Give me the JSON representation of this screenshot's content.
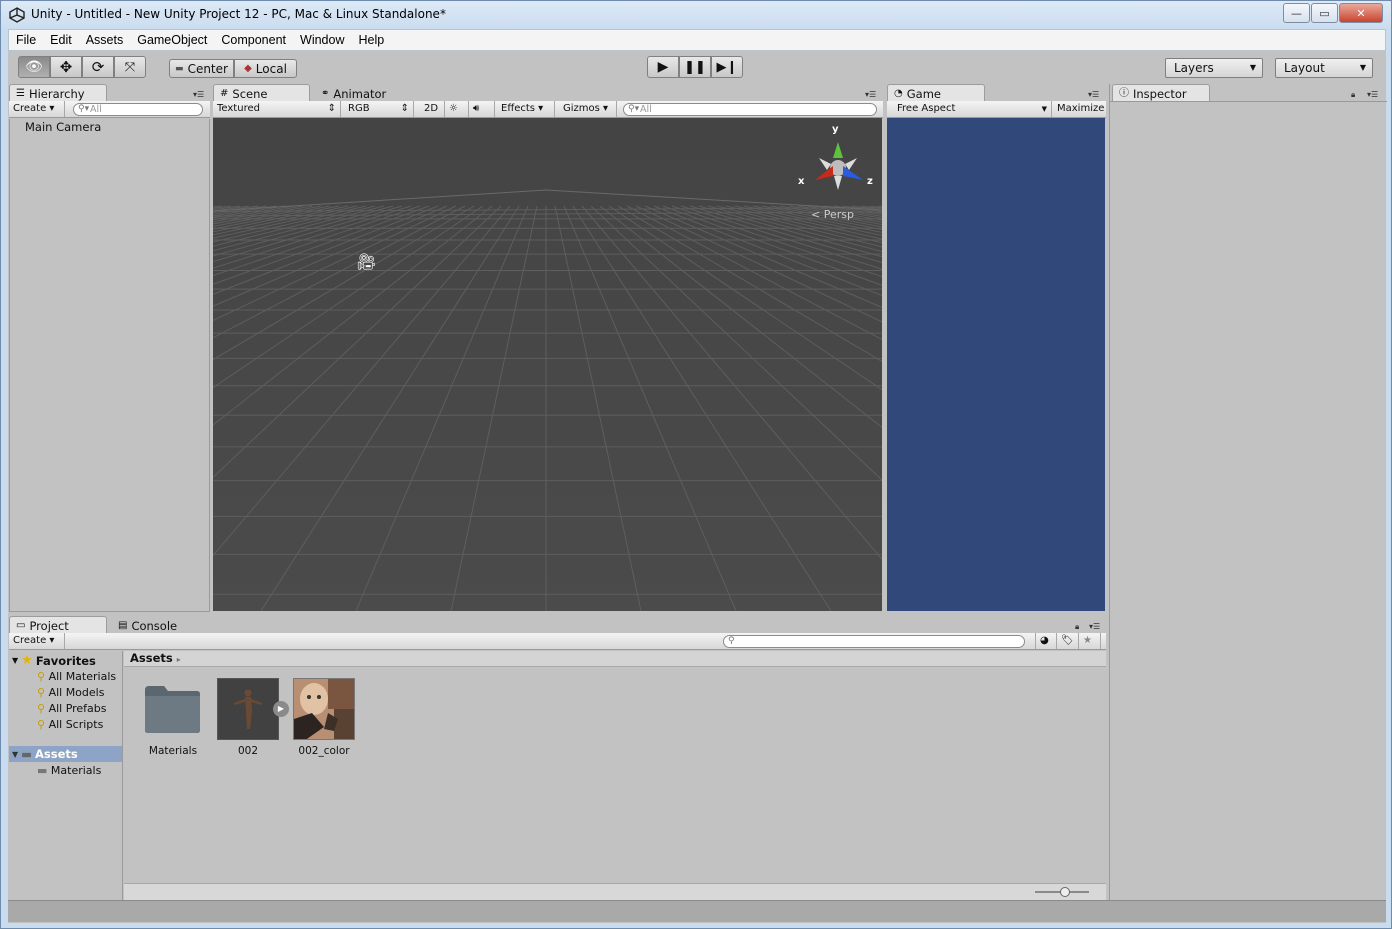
{
  "window": {
    "title": "Unity - Untitled - New Unity Project 12 - PC, Mac & Linux Standalone*"
  },
  "menubar": [
    "File",
    "Edit",
    "Assets",
    "GameObject",
    "Component",
    "Window",
    "Help"
  ],
  "toolbar": {
    "tools": [
      "view-hand",
      "move",
      "rotate",
      "scale"
    ],
    "pivot": "Center",
    "space": "Local",
    "layers": "Layers",
    "layout": "Layout"
  },
  "hierarchy": {
    "tab": "Hierarchy",
    "create": "Create",
    "search_placeholder": "All",
    "items": [
      "Main Camera"
    ]
  },
  "scene": {
    "tabs": [
      "Scene",
      "Animator"
    ],
    "render_mode": "Textured",
    "channel": "RGB",
    "mode2d": "2D",
    "effects": "Effects",
    "gizmos": "Gizmos",
    "search_placeholder": "All",
    "axis_x": "x",
    "axis_y": "y",
    "axis_z": "z",
    "projection": "Persp"
  },
  "game": {
    "tab": "Game",
    "aspect": "Free Aspect",
    "maximize": "Maximize",
    "bg_color": "#31497a"
  },
  "inspector": {
    "tab": "Inspector"
  },
  "project": {
    "tabs": [
      "Project",
      "Console"
    ],
    "create": "Create",
    "favorites_label": "Favorites",
    "favorites": [
      "All Materials",
      "All Models",
      "All Prefabs",
      "All Scripts"
    ],
    "assets_label": "Assets",
    "asset_folders": [
      "Materials"
    ],
    "breadcrumb": "Assets",
    "items": [
      {
        "name": "Materials",
        "kind": "folder"
      },
      {
        "name": "002",
        "kind": "model"
      },
      {
        "name": "002_color",
        "kind": "texture"
      }
    ]
  }
}
